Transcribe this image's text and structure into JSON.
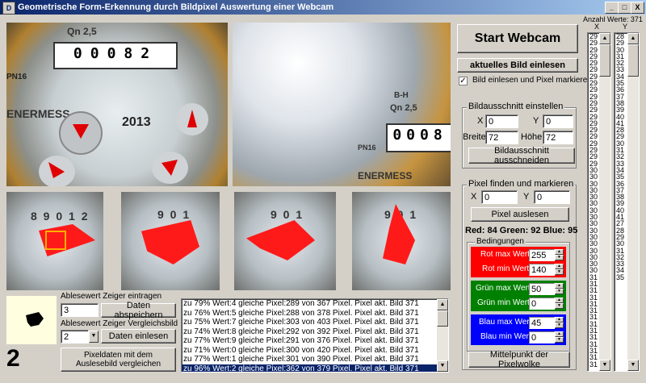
{
  "window": {
    "title": "Geometrische Form-Erkennung durch Bildpixel Auswertung einer Webcam",
    "app_icon": "D",
    "controls": [
      "_",
      "□",
      "X"
    ]
  },
  "camera": {
    "counter_digits": "00082",
    "model_label": "Qn 2,5",
    "brand": "ENERMESS",
    "year": "2013",
    "pn_label": "PN16",
    "zoom_counter_digits": "0008",
    "zoom_model": "Qn 2,5",
    "zoom_bh": "B-H"
  },
  "buttons": {
    "start_webcam": "Start Webcam",
    "aktuelles_bild": "aktuelles Bild einlesen",
    "bildausschnitt": "Bildausschnitt ausschneiden",
    "pixel_auslesen": "Pixel auslesen",
    "daten_abspeichern": "Daten abspeichern",
    "daten_einlesen": "Daten einlesen",
    "pixeldaten_vergleichen": "Pixeldaten mit dem Auslesebild vergleichen",
    "mittelpunkt": "Mittelpunkt der Pixelwolke"
  },
  "checkbox": {
    "label": "Bild einlesen und Pixel markieren",
    "checked": "✓"
  },
  "ausschnitt": {
    "group_title": "Bildausschnitt einstellen",
    "x_label": "X",
    "x_value": "0",
    "y_label": "Y",
    "y_value": "0",
    "breite_label": "Breite",
    "breite_value": "72",
    "hoehe_label": "Höhe",
    "hoehe_value": "72"
  },
  "pixel": {
    "group_title": "Pixel finden und markieren",
    "x_label": "X",
    "x_value": "0",
    "y_label": "Y",
    "y_value": "0",
    "rgb_text": "Red: 84 Green: 92 Blue: 95"
  },
  "bedingungen": {
    "title": "Bedingungen",
    "rot_max_label": "Rot max Wert",
    "rot_max": "255",
    "rot_min_label": "Rot min Wert",
    "rot_min": "140",
    "gruen_max_label": "Grün max Wert",
    "gruen_max": "50",
    "gruen_min_label": "Grün min Wert",
    "gruen_min": "0",
    "blau_max_label": "Blau max Wert",
    "blau_max": "45",
    "blau_min_label": "Blau min Wert",
    "blau_min": "0",
    "colors": {
      "red": "#ff0000",
      "green": "#008000",
      "blue": "#0000ff"
    }
  },
  "ablese": {
    "zeiger_label": "Ablesewert Zeiger eintragen",
    "zeiger_value": "3",
    "vergleich_label": "Ablesewert Zeiger Vergleichsbild",
    "vergleich_value": "2",
    "result_digit": "2"
  },
  "anzahl": {
    "label": "Anzahl Werte: 371",
    "col_x": "X",
    "col_y": "Y",
    "x_values": [
      "29",
      "29",
      "29",
      "29",
      "29",
      "29",
      "29",
      "29",
      "29",
      "29",
      "29",
      "29",
      "29",
      "29",
      "29",
      "29",
      "29",
      "29",
      "29",
      "29",
      "30",
      "30",
      "30",
      "30",
      "30",
      "30",
      "30",
      "30",
      "30",
      "30",
      "30",
      "30",
      "30",
      "30",
      "30",
      "30",
      "31",
      "31",
      "31",
      "31",
      "31",
      "31",
      "31",
      "31",
      "31",
      "31",
      "31",
      "31",
      "31",
      "31",
      "31",
      "31",
      "31"
    ],
    "y_values": [
      "28",
      "29",
      "30",
      "31",
      "32",
      "33",
      "34",
      "35",
      "36",
      "37",
      "38",
      "39",
      "40",
      "41",
      "28",
      "29",
      "30",
      "31",
      "32",
      "33",
      "34",
      "35",
      "36",
      "37",
      "38",
      "39",
      "40",
      "41",
      "27",
      "28",
      "29",
      "30",
      "31",
      "32",
      "33",
      "34",
      "35"
    ]
  },
  "log": [
    "zu 79% Wert:4 gleiche Pixel:289 von 367 Pixel. Pixel akt. Bild 371",
    "zu 76% Wert:5 gleiche Pixel:288 von 378 Pixel. Pixel akt. Bild 371",
    "zu 75% Wert:7 gleiche Pixel:303 von 403 Pixel. Pixel akt. Bild 371",
    "zu 74% Wert:8 gleiche Pixel:292 von 392 Pixel. Pixel akt. Bild 371",
    "zu 77% Wert:9 gleiche Pixel:291 von 376 Pixel. Pixel akt. Bild 371",
    "zu 71% Wert:0 gleiche Pixel:300 von 420 Pixel. Pixel akt. Bild 371",
    "zu 77% Wert:1 gleiche Pixel:301 von 390 Pixel. Pixel akt. Bild 371",
    "zu 96% Wert:2 gleiche Pixel:362 von 379 Pixel. Pixel akt. Bild 371"
  ],
  "dials": {
    "dial1_text": "8 9 0 1 2",
    "dial2_text": "9 0 1",
    "dial3_text": "9 0 1",
    "dial4_text": "9 0 1"
  }
}
